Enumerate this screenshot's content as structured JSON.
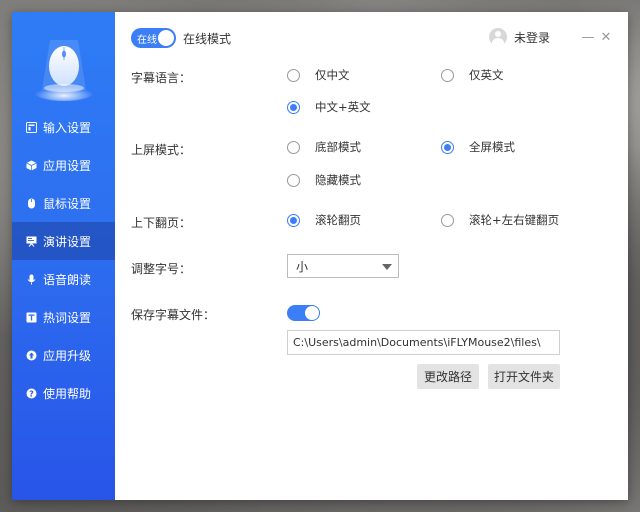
{
  "topbar": {
    "mode_badge": "在线",
    "mode_label": "在线模式",
    "user_label": "未登录",
    "minimize": "—",
    "close": "✕"
  },
  "sidebar": {
    "items": [
      {
        "label": "输入设置",
        "icon": "keyboard-icon"
      },
      {
        "label": "应用设置",
        "icon": "app-icon"
      },
      {
        "label": "鼠标设置",
        "icon": "mouse-icon"
      },
      {
        "label": "演讲设置",
        "icon": "presentation-icon",
        "active": true
      },
      {
        "label": "语音朗读",
        "icon": "microphone-icon"
      },
      {
        "label": "热词设置",
        "icon": "hotword-icon"
      },
      {
        "label": "应用升级",
        "icon": "upgrade-icon"
      },
      {
        "label": "使用帮助",
        "icon": "help-icon"
      }
    ]
  },
  "settings": {
    "subtitle_language": {
      "label": "字幕语言：",
      "options": [
        "仅中文",
        "仅英文",
        "中文+英文"
      ],
      "selected": "中文+英文"
    },
    "screen_mode": {
      "label": "上屏模式：",
      "options": [
        "底部模式",
        "全屏模式",
        "隐藏模式"
      ],
      "selected": "全屏模式"
    },
    "page_turn": {
      "label": "上下翻页：",
      "options": [
        "滚轮翻页",
        "滚轮+左右键翻页"
      ],
      "selected": "滚轮翻页"
    },
    "font_size": {
      "label": "调整字号：",
      "value": "小"
    },
    "save_file": {
      "label": "保存字幕文件：",
      "enabled": true,
      "path": "C:\\Users\\admin\\Documents\\iFLYMouse2\\files\\",
      "change_path_label": "更改路径",
      "open_folder_label": "打开文件夹"
    }
  },
  "colors": {
    "accent": "#3b7ef6",
    "sidebar_top": "#2f7cf6",
    "sidebar_bottom": "#2855e8"
  }
}
